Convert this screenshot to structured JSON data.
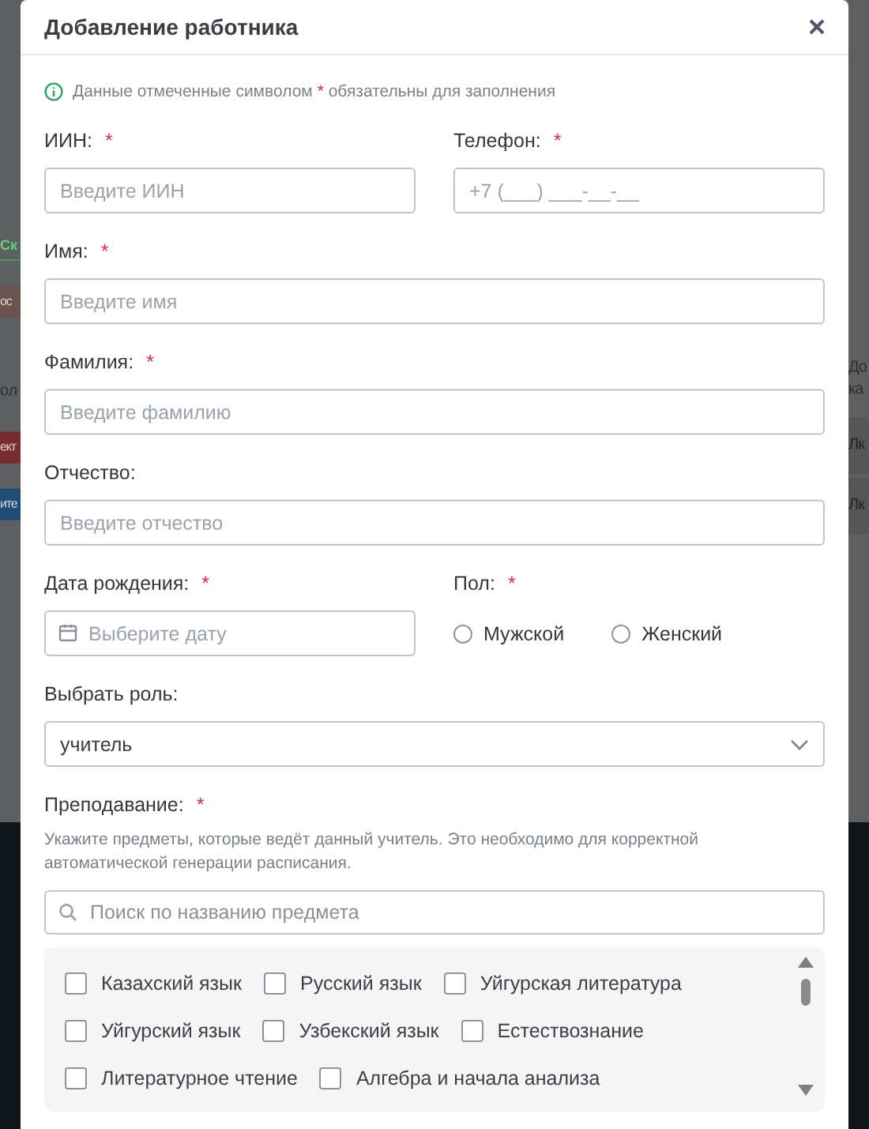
{
  "backdrop": {
    "left": [
      {
        "kind": "link",
        "text": "Ск"
      },
      {
        "kind": "button",
        "text": "ос",
        "color": "#6a5350"
      },
      {
        "kind": "text",
        "text": "ол"
      },
      {
        "kind": "button",
        "text": "ект",
        "color": "#7a2c2c"
      },
      {
        "kind": "button",
        "text": "ите",
        "color": "#1f4d78"
      }
    ],
    "right": [
      {
        "kind": "text",
        "text": "До"
      },
      {
        "kind": "text",
        "text": "ка"
      },
      {
        "kind": "cell",
        "text": "Лк"
      },
      {
        "kind": "cell",
        "text": "Лк"
      }
    ]
  },
  "dialog": {
    "title": "Добавление работника",
    "notice": {
      "before": "Данные отмеченные символом",
      "mark": "*",
      "after": "обязательны для заполнения"
    },
    "rows": [
      [
        {
          "kind": "text",
          "label": "ИИН:",
          "required_mark": "*",
          "placeholder": "Введите ИИН"
        },
        {
          "kind": "text",
          "label": "Телефон:",
          "required_mark": "*",
          "placeholder": "+7 (___) ___-__-__"
        }
      ],
      [
        {
          "kind": "text",
          "label": "Имя:",
          "required_mark": "*",
          "placeholder": "Введите имя"
        }
      ],
      [
        {
          "kind": "text",
          "label": "Фамилия:",
          "required_mark": "*",
          "placeholder": "Введите фамилию"
        }
      ],
      [
        {
          "kind": "text",
          "label": "Отчество:",
          "placeholder": "Введите отчество"
        }
      ],
      [
        {
          "kind": "date",
          "label": "Дата рождения:",
          "required_mark": "*",
          "placeholder": "Выберите дату"
        },
        {
          "kind": "radio",
          "label": "Пол:",
          "required_mark": "*",
          "options": [
            {
              "label": "Мужской",
              "selected": false
            },
            {
              "label": "Женский",
              "selected": false
            }
          ]
        }
      ],
      [
        {
          "kind": "select",
          "label": "Выбрать роль:",
          "value": "учитель"
        }
      ]
    ],
    "teaching": {
      "label": "Преподавание:",
      "required_mark": "*",
      "hint": "Укажите предметы, которые ведёт данный учитель. Это необходимо для корректной автоматической генерации расписания.",
      "search_placeholder": "Поиск по названию предмета",
      "subjects": [
        [
          {
            "label": "Казахский язык",
            "checked": false
          },
          {
            "label": "Русский язык",
            "checked": false
          },
          {
            "label": "Уйгурская литература",
            "checked": false
          }
        ],
        [
          {
            "label": "Уйгурский язык",
            "checked": false
          },
          {
            "label": "Узбекский язык",
            "checked": false
          },
          {
            "label": "Естествознание",
            "checked": false
          }
        ],
        [
          {
            "label": "Литературное чтение",
            "checked": false
          },
          {
            "label": "Алгебра и начала анализа",
            "checked": false
          }
        ]
      ]
    }
  }
}
